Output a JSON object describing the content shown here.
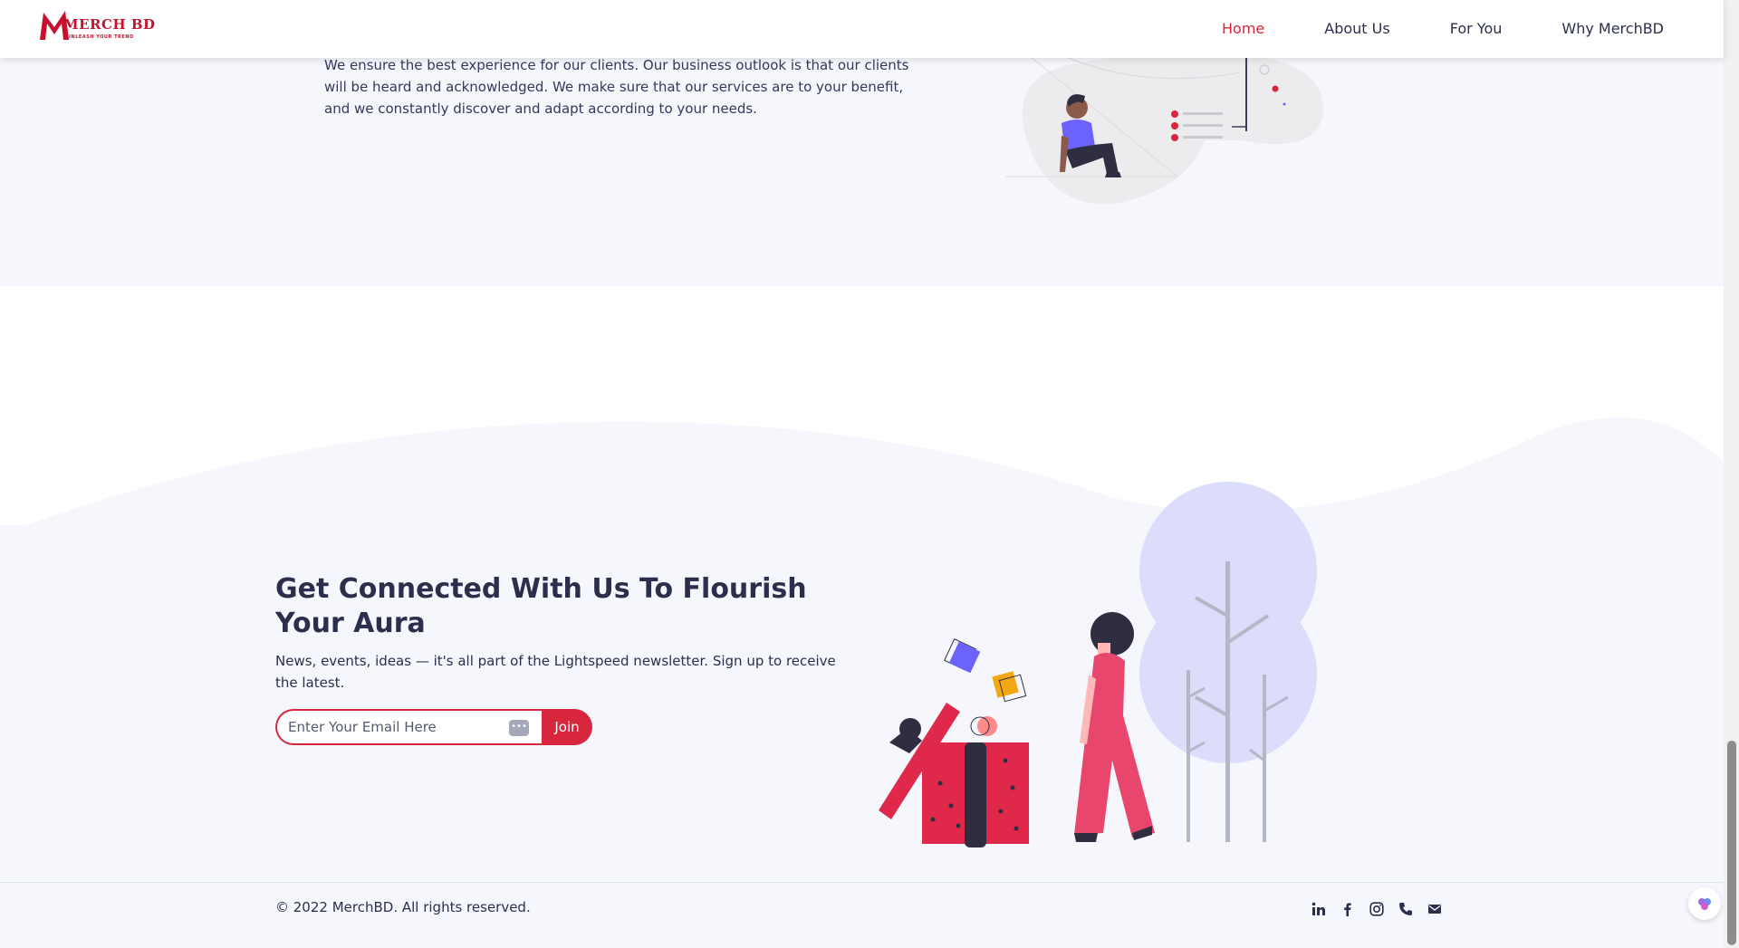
{
  "header": {
    "logo_text": "MERCH BD",
    "logo_tagline": "UNLEASH YOUR TREND",
    "nav": [
      {
        "label": "Home",
        "active": true
      },
      {
        "label": "About Us",
        "active": false
      },
      {
        "label": "For You",
        "active": false
      },
      {
        "label": "Why MerchBD",
        "active": false
      }
    ]
  },
  "top": {
    "text": "We ensure the best experience for our clients. Our business outlook is that our clients will be heard and acknowledged. We make sure that our services are to your benefit, and we constantly discover and adapt according to your needs."
  },
  "connect": {
    "title": "Get Connected With Us To Flourish Your Aura",
    "subtitle": "News, events, ideas — it's all part of the Lightspeed newsletter. Sign up to receive the latest.",
    "email_placeholder": "Enter Your Email Here",
    "join_label": "Join"
  },
  "footer": {
    "copyright": "© 2022 MerchBD. All rights reserved.",
    "socials": [
      "linkedin-icon",
      "facebook-icon",
      "instagram-icon",
      "phone-icon",
      "mail-icon"
    ]
  },
  "colors": {
    "accent": "#d7263d",
    "text": "#2b2f4c",
    "section_bg": "#f5f7fd",
    "tree": "#dcdcfb"
  }
}
